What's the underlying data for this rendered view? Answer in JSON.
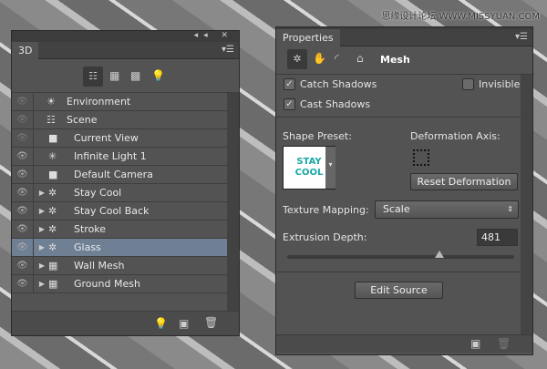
{
  "watermark": "思缘设计论坛 WWW.MISSYUAN.COM",
  "panel3d": {
    "tab": "3D",
    "filter_icons": [
      "scene-filter-icon",
      "mesh-filter-icon",
      "material-filter-icon",
      "light-filter-icon"
    ],
    "items": [
      {
        "label": "Environment",
        "icon": "environment-icon",
        "eye": "dim",
        "indent": 0,
        "expand": false,
        "selected": false
      },
      {
        "label": "Scene",
        "icon": "scene-icon",
        "eye": "dim",
        "indent": 0,
        "expand": false,
        "selected": false
      },
      {
        "label": "Current View",
        "icon": "camera-icon",
        "eye": "dim",
        "indent": 1,
        "expand": false,
        "selected": false
      },
      {
        "label": "Infinite Light 1",
        "icon": "light-icon",
        "eye": "on",
        "indent": 1,
        "expand": false,
        "selected": false
      },
      {
        "label": "Default Camera",
        "icon": "camera-icon",
        "eye": "on",
        "indent": 1,
        "expand": false,
        "selected": false
      },
      {
        "label": "Stay  Cool",
        "icon": "mesh-icon",
        "eye": "on",
        "indent": 1,
        "expand": true,
        "selected": false
      },
      {
        "label": "Stay  Cool Back",
        "icon": "mesh-icon",
        "eye": "on",
        "indent": 1,
        "expand": true,
        "selected": false
      },
      {
        "label": "Stroke",
        "icon": "mesh-icon",
        "eye": "on",
        "indent": 1,
        "expand": true,
        "selected": false
      },
      {
        "label": "Glass",
        "icon": "mesh-icon",
        "eye": "on",
        "indent": 1,
        "expand": true,
        "selected": true
      },
      {
        "label": "Wall Mesh",
        "icon": "wall-mesh-icon",
        "eye": "on",
        "indent": 1,
        "expand": true,
        "selected": false
      },
      {
        "label": "Ground Mesh",
        "icon": "wall-mesh-icon",
        "eye": "on",
        "indent": 1,
        "expand": true,
        "selected": false
      }
    ]
  },
  "properties": {
    "tab": "Properties",
    "section": "Mesh",
    "catch_shadows": "Catch Shadows",
    "cast_shadows": "Cast Shadows",
    "invisible": "Invisible",
    "shape_preset_label": "Shape Preset:",
    "preset_text": "STAY COOL",
    "deformation_axis_label": "Deformation Axis:",
    "reset_deformation": "Reset Deformation",
    "texture_mapping_label": "Texture Mapping:",
    "texture_mapping_value": "Scale",
    "extrusion_depth_label": "Extrusion Depth:",
    "extrusion_depth_value": "481",
    "extrusion_slider_fraction": 0.67,
    "edit_source": "Edit Source"
  },
  "colors": {
    "panel": "#535353",
    "selected": "#6f7f94",
    "preset": "#1aa6a6"
  }
}
